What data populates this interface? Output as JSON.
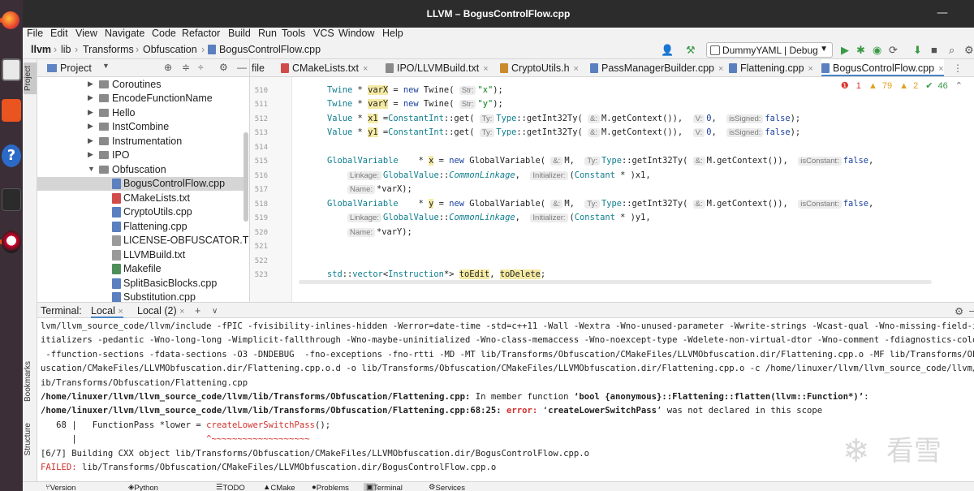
{
  "window": {
    "title": "LLVM – BogusControlFlow.cpp"
  },
  "menu": [
    "File",
    "Edit",
    "View",
    "Navigate",
    "Code",
    "Refactor",
    "Build",
    "Run",
    "Tools",
    "VCS",
    "Window",
    "Help"
  ],
  "breadcrumb": [
    "llvm",
    "lib",
    "Transforms",
    "Obfuscation",
    "BogusControlFlow.cpp"
  ],
  "toolbar": {
    "run_config": "DummyYAML | Debug"
  },
  "project": {
    "title": "Project",
    "items": [
      {
        "label": "Coroutines",
        "type": "folder"
      },
      {
        "label": "EncodeFunctionName",
        "type": "folder"
      },
      {
        "label": "Hello",
        "type": "folder"
      },
      {
        "label": "InstCombine",
        "type": "folder"
      },
      {
        "label": "Instrumentation",
        "type": "folder"
      },
      {
        "label": "IPO",
        "type": "folder"
      },
      {
        "label": "Obfuscation",
        "type": "folder-open"
      },
      {
        "label": "BogusControlFlow.cpp",
        "type": "cpp"
      },
      {
        "label": "CMakeLists.txt",
        "type": "cmake"
      },
      {
        "label": "CryptoUtils.cpp",
        "type": "cpp"
      },
      {
        "label": "Flattening.cpp",
        "type": "cpp"
      },
      {
        "label": "LICENSE-OBFUSCATOR.TXT",
        "type": "txt"
      },
      {
        "label": "LLVMBuild.txt",
        "type": "txt"
      },
      {
        "label": "Makefile",
        "type": "make"
      },
      {
        "label": "SplitBasicBlocks.cpp",
        "type": "cpp"
      },
      {
        "label": "Substitution.cpp",
        "type": "cpp"
      }
    ]
  },
  "tabs": [
    {
      "label": "file",
      "color": "#8a8a8a"
    },
    {
      "label": "CMakeLists.txt",
      "color": "#d24b4b"
    },
    {
      "label": "IPO/LLVMBuild.txt",
      "color": "#8a8a8a"
    },
    {
      "label": "CryptoUtils.h",
      "color": "#c98b2b"
    },
    {
      "label": "PassManagerBuilder.cpp",
      "color": "#5b7fbf"
    },
    {
      "label": "Flattening.cpp",
      "color": "#5b7fbf"
    },
    {
      "label": "BogusControlFlow.cpp",
      "color": "#5b7fbf"
    }
  ],
  "inspections": {
    "errors": "1",
    "warnings": "79",
    "weak": "2",
    "ok": "46"
  },
  "line_numbers": [
    "510",
    "511",
    "512",
    "513",
    "514",
    "515",
    "516",
    "517",
    "518",
    "519",
    "520",
    "521",
    "522",
    "523"
  ],
  "terminal": {
    "label": "Terminal:",
    "tabs": [
      "Local",
      "Local (2)"
    ],
    "lines": [
      "lvm/llvm_source_code/llvm/include -fPIC -fvisibility-inlines-hidden -Werror=date-time -std=c++11 -Wall -Wextra -Wno-unused-parameter -Wwrite-strings -Wcast-qual -Wno-missing-field-in",
      "itializers -pedantic -Wno-long-long -Wimplicit-fallthrough -Wno-maybe-uninitialized -Wno-class-memaccess -Wno-noexcept-type -Wdelete-non-virtual-dtor -Wno-comment -fdiagnostics-colo",
      " -ffunction-sections -fdata-sections -O3 -DNDEBUG  -fno-exceptions -fno-rtti -MD -MT lib/Transforms/Obfuscation/CMakeFiles/LLVMObfuscation.dir/Flattening.cpp.o -MF lib/Transforms/Ob",
      "uscation/CMakeFiles/LLVMObfuscation.dir/Flattening.cpp.o.d -o lib/Transforms/Obfuscation/CMakeFiles/LLVMObfuscation.dir/Flattening.cpp.o -c /home/linuxer/llvm/llvm_source_code/llvm/",
      "ib/Transforms/Obfuscation/Flattening.cpp"
    ],
    "in_member_path": "/home/linuxer/llvm/llvm_source_code/llvm/lib/Transforms/Obfuscation/Flattening.cpp:",
    "in_member_text": " In member function ",
    "in_member_fn": "‘bool {anonymous}::Flattening::flatten(llvm::Function*)’",
    "in_member_end": ":",
    "error_path": "/home/linuxer/llvm/llvm_source_code/llvm/lib/Transforms/Obfuscation/Flattening.cpp:68:25:",
    "error_word": " error:",
    "error_msg_pre": " ‘",
    "error_sym": "createLowerSwitchPass",
    "error_msg_post": "’ was not declared in this scope",
    "src_line_pre": "   68 |   FunctionPass *lower = ",
    "src_line_call": "createLowerSwitchPass",
    "src_line_post": "();",
    "caret_pre": "      |                         ",
    "caret": "^~~~~~~~~~~~~~~~~~~~",
    "building": "[6/7] Building CXX object lib/Transforms/Obfuscation/CMakeFiles/LLVMObfuscation.dir/BogusControlFlow.cpp.o",
    "failed_word": "FAILED:",
    "failed_text": " lib/Transforms/Obfuscation/CMakeFiles/LLVMObfuscation.dir/BogusControlFlow.cpp.o"
  },
  "left_strip": {
    "project": "Project",
    "bookmarks": "Bookmarks",
    "structure": "Structure"
  },
  "bottom_tools": [
    "Version Control",
    "Python Packages",
    "TODO",
    "CMake",
    "Problems",
    "Terminal",
    "Services"
  ],
  "watermark": {
    "text": "看雪"
  }
}
